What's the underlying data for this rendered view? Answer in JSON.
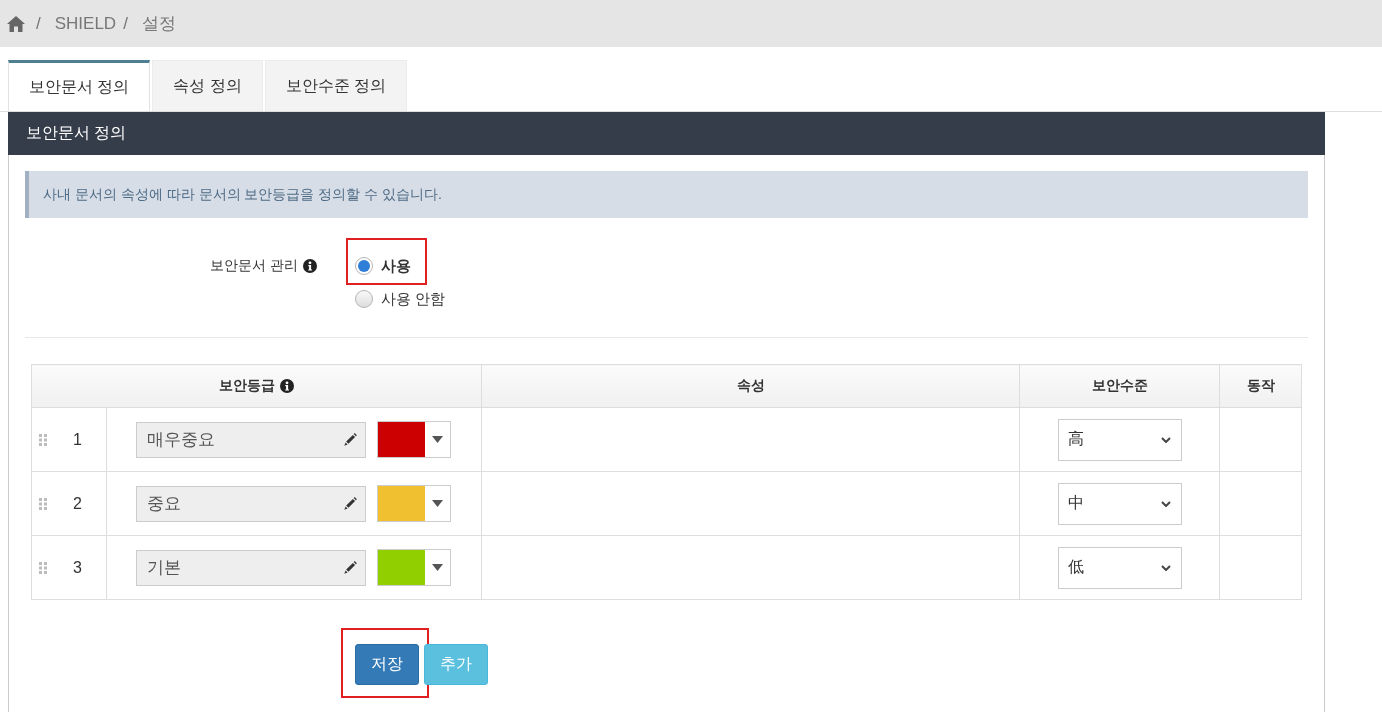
{
  "breadcrumb": {
    "items": [
      {
        "separator": "/",
        "label": "SHIELD"
      },
      {
        "separator": "/",
        "label": "설정"
      }
    ]
  },
  "tabs": [
    {
      "label": "보안문서 정의",
      "selected": true
    },
    {
      "label": "속성 정의",
      "selected": false
    },
    {
      "label": "보안수준 정의",
      "selected": false
    }
  ],
  "panel": {
    "title": "보안문서 정의",
    "notice": "사내 문서의 속성에 따라 문서의 보안등급을 정의할 수 있습니다.",
    "setting": {
      "label": "보안문서 관리",
      "info": true,
      "options": [
        {
          "label": "사용",
          "selected": true,
          "highlighted": true
        },
        {
          "label": "사용 안함",
          "selected": false,
          "highlighted": false
        }
      ]
    },
    "table": {
      "columns": [
        {
          "label": "보안등급",
          "info": true
        },
        {
          "label": "속성",
          "info": false
        },
        {
          "label": "보안수준",
          "info": false
        },
        {
          "label": "동작",
          "info": false
        }
      ],
      "rows": [
        {
          "number": "1",
          "name": "매우중요",
          "color": "#cc0000",
          "level": "高"
        },
        {
          "number": "2",
          "name": "중요",
          "color": "#f0c030",
          "level": "中"
        },
        {
          "number": "3",
          "name": "기본",
          "color": "#92cf00",
          "level": "低"
        }
      ]
    },
    "buttons": [
      {
        "label": "저장",
        "kind": "primary",
        "highlighted": true
      },
      {
        "label": "추가",
        "kind": "info",
        "highlighted": false
      }
    ]
  }
}
